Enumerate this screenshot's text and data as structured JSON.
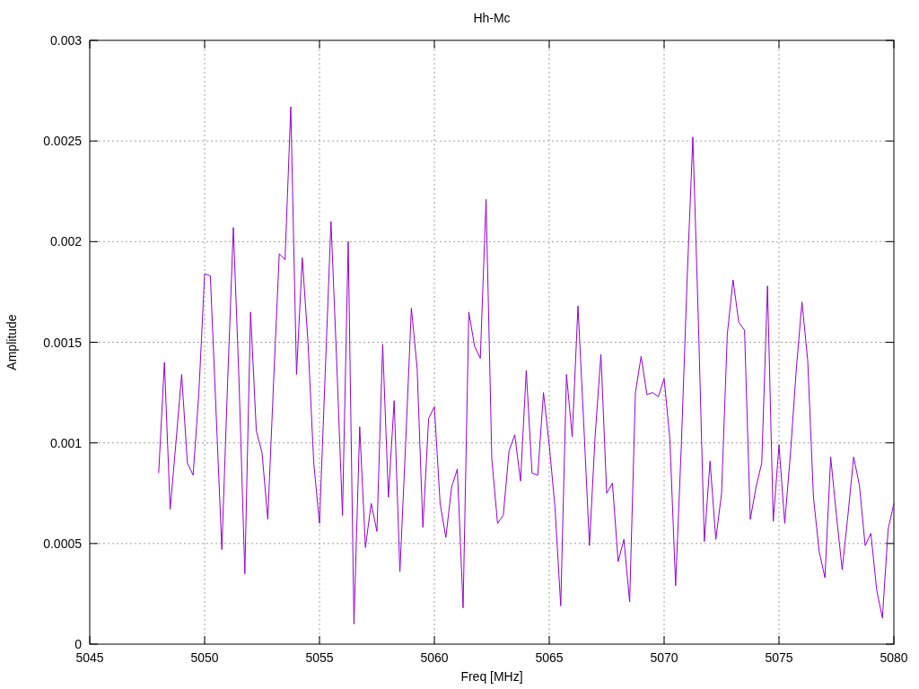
{
  "chart_data": {
    "type": "line",
    "grid": true,
    "title": "Hh-Mc",
    "xlabel": "Freq [MHz]",
    "ylabel": "Amplitude",
    "xlim": [
      5045,
      5080
    ],
    "ylim": [
      0,
      0.003
    ],
    "xticks": [
      5045,
      5050,
      5055,
      5060,
      5065,
      5070,
      5075,
      5080
    ],
    "yticks": [
      0,
      0.0005,
      0.001,
      0.0015,
      0.002,
      0.0025,
      0.003
    ],
    "x": [
      5048,
      5048.25,
      5048.5,
      5048.75,
      5049,
      5049.25,
      5049.5,
      5049.75,
      5050,
      5050.25,
      5050.5,
      5050.75,
      5051,
      5051.25,
      5051.5,
      5051.75,
      5052,
      5052.25,
      5052.5,
      5052.75,
      5053,
      5053.25,
      5053.5,
      5053.75,
      5054,
      5054.25,
      5054.5,
      5054.75,
      5055,
      5055.25,
      5055.5,
      5055.75,
      5056,
      5056.25,
      5056.5,
      5056.75,
      5057,
      5057.25,
      5057.5,
      5057.75,
      5058,
      5058.25,
      5058.5,
      5058.75,
      5059,
      5059.25,
      5059.5,
      5059.75,
      5060,
      5060.25,
      5060.5,
      5060.75,
      5061,
      5061.25,
      5061.5,
      5061.75,
      5062,
      5062.25,
      5062.5,
      5062.75,
      5063,
      5063.25,
      5063.5,
      5063.75,
      5064,
      5064.25,
      5064.5,
      5064.75,
      5065,
      5065.25,
      5065.5,
      5065.75,
      5066,
      5066.25,
      5066.5,
      5066.75,
      5067,
      5067.25,
      5067.5,
      5067.75,
      5068,
      5068.25,
      5068.5,
      5068.75,
      5069,
      5069.25,
      5069.5,
      5069.75,
      5070,
      5070.25,
      5070.5,
      5070.75,
      5071,
      5071.25,
      5071.5,
      5071.75,
      5072,
      5072.25,
      5072.5,
      5072.75,
      5073,
      5073.25,
      5073.5,
      5073.75,
      5074,
      5074.25,
      5074.5,
      5074.75,
      5075,
      5075.25,
      5075.5,
      5075.75,
      5076,
      5076.25,
      5076.5,
      5076.75,
      5077,
      5077.25,
      5077.5,
      5077.75,
      5078,
      5078.25,
      5078.5,
      5078.75,
      5079,
      5079.25,
      5079.5,
      5079.75,
      5080
    ],
    "series": [
      {
        "color": "#9400d3",
        "values": [
          0.00085,
          0.0014,
          0.00067,
          0.001,
          0.00134,
          0.0009,
          0.00084,
          0.00125,
          0.00184,
          0.00183,
          0.00115,
          0.00047,
          0.0013,
          0.00207,
          0.0013,
          0.00035,
          0.00165,
          0.00106,
          0.00095,
          0.00062,
          0.0013,
          0.00194,
          0.00191,
          0.00267,
          0.00134,
          0.00192,
          0.0015,
          0.0009,
          0.0006,
          0.00135,
          0.0021,
          0.0014,
          0.00064,
          0.002,
          0.0001,
          0.00108,
          0.00048,
          0.0007,
          0.00056,
          0.00149,
          0.00073,
          0.00121,
          0.00036,
          0.001,
          0.00167,
          0.00137,
          0.00058,
          0.00112,
          0.00118,
          0.0007,
          0.00053,
          0.00078,
          0.00087,
          0.00018,
          0.00165,
          0.00148,
          0.00142,
          0.00221,
          0.00092,
          0.0006,
          0.00064,
          0.00096,
          0.00104,
          0.00081,
          0.00136,
          0.00085,
          0.00084,
          0.00125,
          0.00099,
          0.00068,
          0.00019,
          0.00134,
          0.00103,
          0.00168,
          0.0011,
          0.00049,
          0.00104,
          0.00144,
          0.00075,
          0.0008,
          0.00041,
          0.00052,
          0.00021,
          0.00125,
          0.00143,
          0.00124,
          0.00125,
          0.00123,
          0.00132,
          0.00102,
          0.00029,
          0.00099,
          0.00181,
          0.00252,
          0.00157,
          0.00051,
          0.00091,
          0.00052,
          0.00075,
          0.00154,
          0.00181,
          0.0016,
          0.00156,
          0.00062,
          0.00078,
          0.0009,
          0.00178,
          0.00061,
          0.00099,
          0.0006,
          0.00095,
          0.00136,
          0.0017,
          0.00141,
          0.00073,
          0.00046,
          0.00033,
          0.00093,
          0.00064,
          0.00037,
          0.00064,
          0.00093,
          0.00079,
          0.00049,
          0.00055,
          0.00027,
          0.00013,
          0.00057,
          0.0007
        ]
      }
    ]
  }
}
